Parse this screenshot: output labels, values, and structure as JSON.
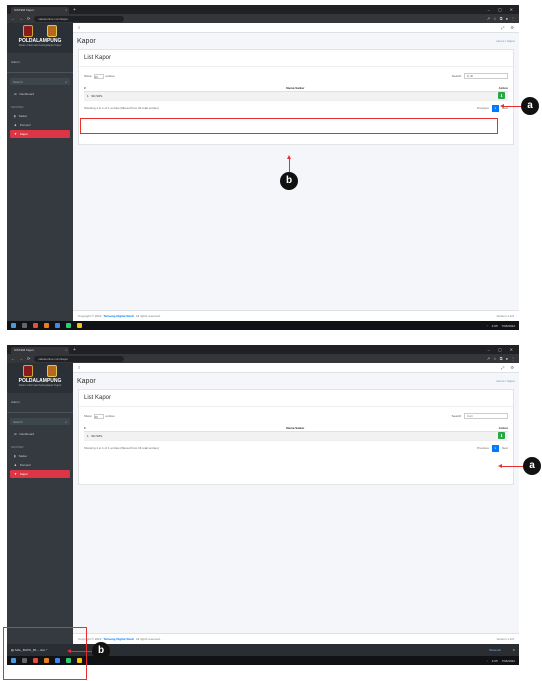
{
  "screens": [
    {
      "browser": {
        "tab_title": "SISTEM Kapor",
        "url": "siakaonline.com/kapor"
      },
      "brand": {
        "name": "POLDALAMPUNG",
        "subtitle": "Sistem Informasi Kelengkapan Kapor"
      },
      "sidebar": {
        "user": "Admin",
        "search_placeholder": "Search",
        "items": [
          {
            "label": "Dashboard"
          },
          {
            "label": "Satker"
          },
          {
            "label": "Personil"
          },
          {
            "label": "Kapor"
          }
        ],
        "section": "MASTER"
      },
      "page": {
        "title": "Kapor",
        "breadcrumb": "Home / Kapor",
        "card_title": "List Kapor",
        "show_label": "Show",
        "show_value": "10",
        "entries_label": "entries",
        "search_label": "Search:",
        "search_value": "lll,dfl",
        "col_no": "#",
        "col_name": "Nama Satker",
        "col_action": "Action",
        "rows": [
          {
            "no": "1",
            "name": "SD.SIPL"
          }
        ],
        "info": "Showing 1 to 1 of 1 entries (filtered from 34 total entries)",
        "prev": "Previous",
        "page": "1",
        "next": "Next"
      },
      "footer": {
        "copyright": "Copyright © 2022",
        "brandlink": "Tanvang Digital Studi",
        "rights": "All rights reserved.",
        "version": "Version 1.0.0"
      },
      "taskbar": {
        "time": "4:05",
        "date": "7/06/2022"
      }
    },
    {
      "browser": {
        "tab_title": "SISTEM Kapor",
        "url": "siakaonline.com/kapor"
      },
      "brand": {
        "name": "POLDALAMPUNG",
        "subtitle": "Sistem Informasi Kelengkapan Kapor"
      },
      "sidebar": {
        "user": "Admin",
        "search_placeholder": "Search",
        "items": [
          {
            "label": "Dashboard"
          },
          {
            "label": "Satker"
          },
          {
            "label": "Personil"
          },
          {
            "label": "Kapor"
          }
        ],
        "section": "MASTER"
      },
      "page": {
        "title": "Kapor",
        "breadcrumb": "Home / Kapor",
        "card_title": "List Kapor",
        "show_label": "Show",
        "show_value": "10",
        "entries_label": "entries",
        "search_label": "Search:",
        "search_value": "Cari",
        "col_no": "#",
        "col_name": "Nama Satker",
        "col_action": "Action",
        "rows": [
          {
            "no": "1",
            "name": "SD.SIPL"
          }
        ],
        "info": "Showing 1 to 1 of 1 entries (filtered from 34 total entries)",
        "prev": "Previous",
        "page": "1",
        "next": "Next"
      },
      "footer": {
        "copyright": "Copyright © 2022",
        "brandlink": "Tanvang Digital Studi",
        "rights": "All rights reserved.",
        "version": "Version 1.0.0"
      },
      "download_bar": {
        "filename": "SIAL_BATIK_B1....xlsx",
        "show_all": "Show all"
      },
      "taskbar": {
        "time": "4:05",
        "date": "7/06/2022"
      }
    }
  ],
  "annotations": {
    "a": "a",
    "b": "b"
  },
  "colors": {
    "accent_red": "#dc3545",
    "annotation_red": "#e63030",
    "download_green": "#28a745",
    "page_blue": "#007bff"
  }
}
